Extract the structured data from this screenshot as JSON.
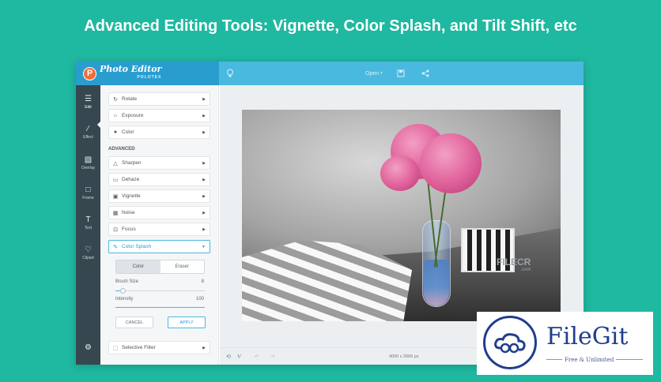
{
  "headline": "Advanced Editing Tools: Vignette, Color Splash, and Tilt Shift, etc",
  "app": {
    "logo": {
      "badge": "P",
      "name": "Photo Editor",
      "sub": "POLOTEX"
    },
    "toolbar": {
      "open_label": "Open",
      "open_caret": "▾"
    },
    "rail": [
      {
        "label": "Edit",
        "icon": "sliders-icon"
      },
      {
        "label": "Effect",
        "icon": "magic-wand-icon"
      },
      {
        "label": "Overlay",
        "icon": "overlay-icon"
      },
      {
        "label": "Frame",
        "icon": "frame-icon"
      },
      {
        "label": "Text",
        "icon": "text-icon"
      },
      {
        "label": "Clipart",
        "icon": "heart-icon"
      }
    ],
    "panel": {
      "basic_tools": [
        "Rotate",
        "Exposure",
        "Color"
      ],
      "section_label": "ADVANCED",
      "advanced_tools": [
        "Sharpen",
        "Dehaze",
        "Vignette",
        "Noise",
        "Focus",
        "Color Splash"
      ],
      "splash": {
        "mode_tabs": [
          "Color",
          "Eraser"
        ],
        "active_mode": "Color",
        "brush_size_label": "Brush Size",
        "brush_size_value": "8",
        "brush_size_fraction": 0.08,
        "intensity_label": "Intensity",
        "intensity_value": "100",
        "intensity_fraction": 1.0,
        "cancel_label": "CANCEL",
        "apply_label": "APPLY"
      },
      "selective_filter_label": "Selective Filter"
    },
    "canvas": {
      "dimensions": "4000 x 2666 px",
      "watermark": "FILECR",
      "watermark_sub": ".com"
    }
  },
  "brand": {
    "name": "FileGit",
    "tagline": "Free & Unlimited",
    "color": "#1f3e8c"
  },
  "colors": {
    "background": "#1fb8a0",
    "titlebar": "#4ab9df",
    "accent": "#2a9dcf",
    "rail": "#37474f"
  }
}
